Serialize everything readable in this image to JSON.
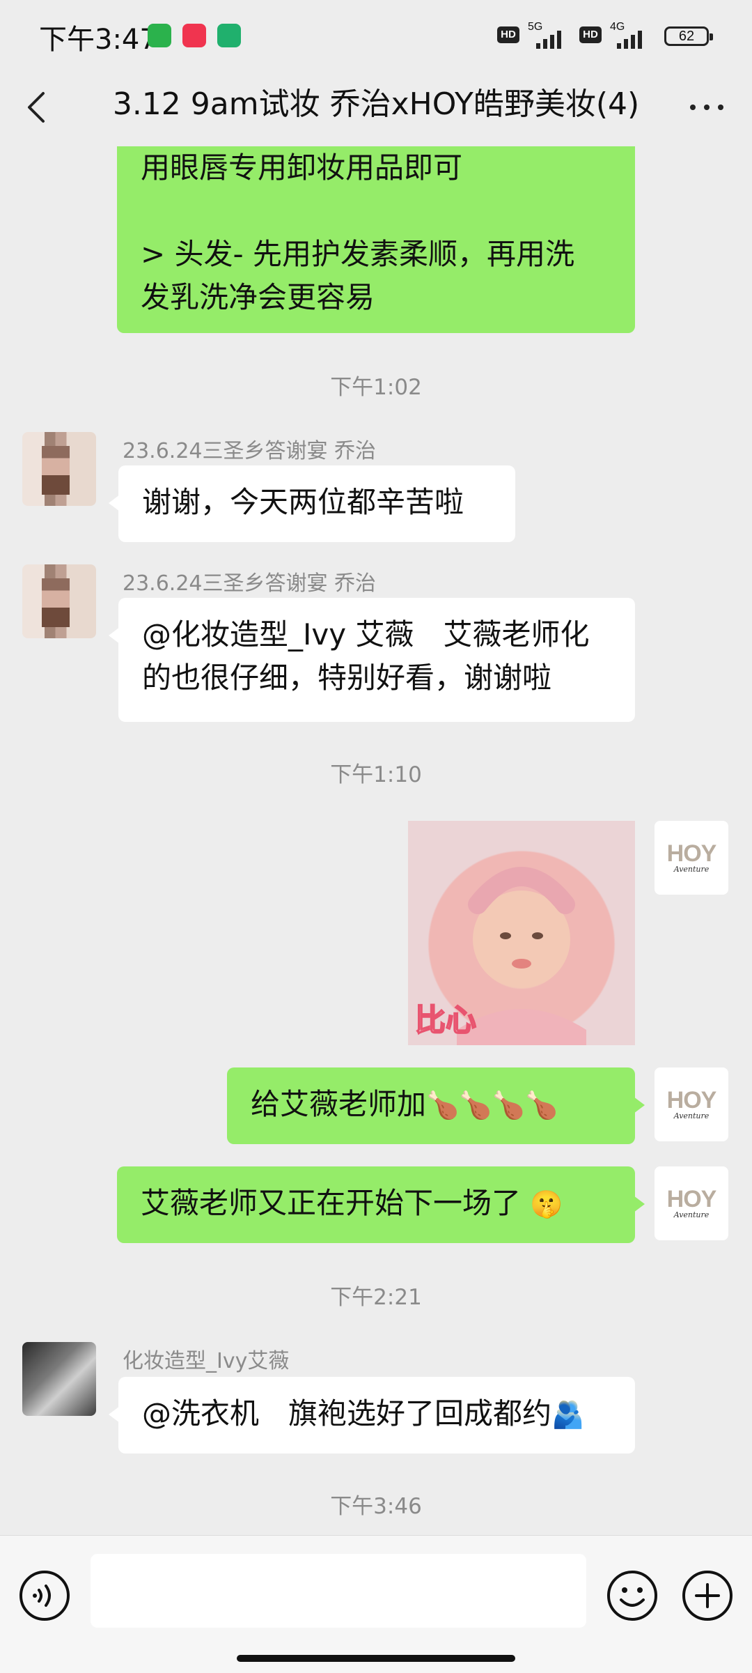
{
  "status_bar": {
    "time": "下午3:47",
    "network_1": "5G",
    "network_2": "4G",
    "hd": "HD",
    "battery": "62"
  },
  "header": {
    "title": "3.12 9am试妆 乔治xHOY皓野美妆(4)"
  },
  "messages": {
    "m1": {
      "line1": "用眼唇专用卸妆用品即可",
      "line2": "> 头发- 先用护发素柔顺，再用洗",
      "line3": "发乳洗净会更容易"
    },
    "t1": "下午1:02",
    "m2": {
      "sender": "23.6.24三圣乡答谢宴 乔治",
      "text": "谢谢，今天两位都辛苦啦"
    },
    "m3": {
      "sender": "23.6.24三圣乡答谢宴 乔治",
      "line1": "@化妆造型_Ivy 艾薇　艾薇老师化",
      "line2": "的也很仔细，特别好看，谢谢啦"
    },
    "t2": "下午1:10",
    "sticker_caption": "比心",
    "m4": {
      "text": "给艾薇老师加",
      "emoji": "🍗🍗🍗🍗"
    },
    "m5": {
      "text": "艾薇老师又正在开始下一场了",
      "emoji": "🤫"
    },
    "t3": "下午2:21",
    "m6": {
      "sender": "化妆造型_Ivy艾薇",
      "text": "@洗衣机　旗袍选好了回成都约",
      "emoji": "🫂"
    },
    "t4": "下午3:46"
  },
  "brand": {
    "hoy": "HOY",
    "hoy_sub": "Aventure"
  },
  "input": {
    "placeholder": ""
  },
  "colors": {
    "green_bubble": "#95ec69",
    "background": "#ededed"
  }
}
